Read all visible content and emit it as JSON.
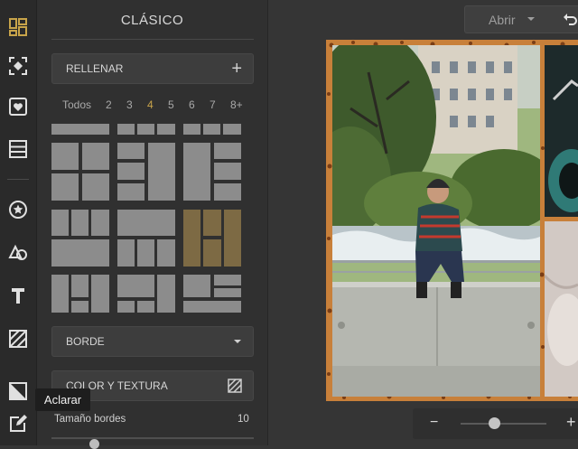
{
  "toolbar": {
    "items": [
      "layout-icon",
      "crop-focus-icon",
      "heart-frame-icon",
      "rows-icon",
      "star-icon",
      "shapes-icon",
      "text-icon",
      "hatch-icon",
      "half-square-icon",
      "edit-icon"
    ],
    "tooltip": "Aclarar"
  },
  "panel": {
    "title": "CLÁSICO",
    "fill_button": "RELLENAR",
    "fill_icon": "+",
    "filters": [
      "Todos",
      "2",
      "3",
      "4",
      "5",
      "6",
      "7",
      "8+"
    ],
    "active_filter": "4",
    "border_dropdown": "BORDE",
    "color_texture_button": "COLOR Y TEXTURA",
    "border_size_label": "Tamaño bordes",
    "border_size_value": "10"
  },
  "header": {
    "open_button": "Abrir"
  },
  "colors": {
    "accent": "#c8a44a",
    "selected_template": "#7d6a44",
    "collage_border": "#c8803a"
  },
  "zoom": {
    "minus": "−",
    "plus": "+",
    "level": 0.35
  }
}
